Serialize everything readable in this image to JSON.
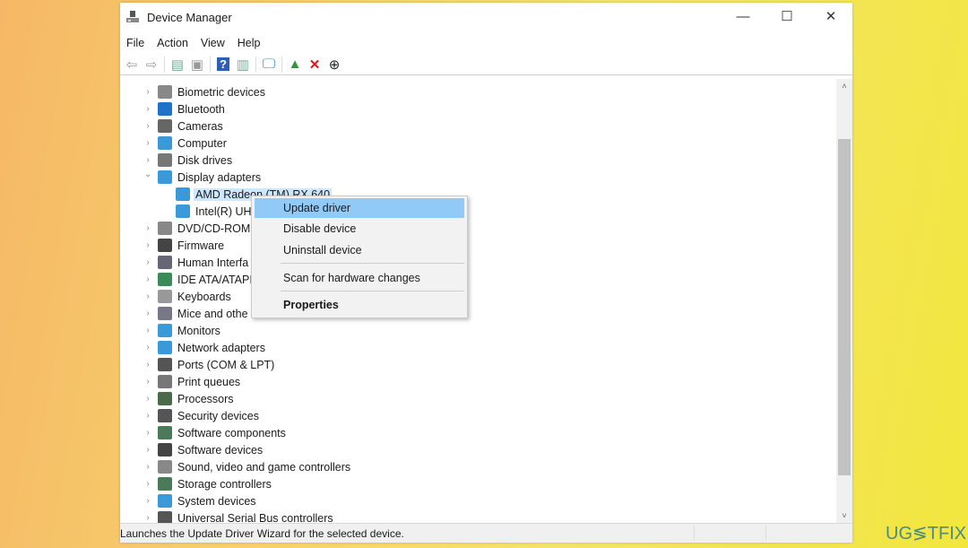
{
  "window": {
    "title": "Device Manager",
    "minimize": "—",
    "maximize": "☐",
    "close": "✕"
  },
  "menu": [
    "File",
    "Action",
    "View",
    "Help"
  ],
  "toolbar": [
    {
      "icon": "back-arrow-icon",
      "glyph": "⇦",
      "color": "#999"
    },
    {
      "icon": "forward-arrow-icon",
      "glyph": "⇨",
      "color": "#999"
    },
    {
      "icon": "show-hide-console-tree-icon",
      "glyph": "▤",
      "color": "#7a9"
    },
    {
      "icon": "properties-icon",
      "glyph": "▣",
      "color": "#999"
    },
    {
      "icon": "help-icon",
      "glyph": "?",
      "color": "#fff"
    },
    {
      "icon": "action-pane-icon",
      "glyph": "▥",
      "color": "#7a9"
    },
    {
      "icon": "monitor-scan-icon",
      "glyph": "🖵",
      "color": "#2a8fd0"
    },
    {
      "icon": "update-driver-icon",
      "glyph": "▲",
      "color": "#2a9a3a"
    },
    {
      "icon": "uninstall-x-icon",
      "glyph": "✕",
      "color": "#e01515"
    },
    {
      "icon": "download-circle-icon",
      "glyph": "⊕",
      "color": "#222"
    }
  ],
  "tree": [
    {
      "label": "Biometric devices",
      "level": 0,
      "expanded": false,
      "color": "#888"
    },
    {
      "label": "Bluetooth",
      "level": 0,
      "expanded": false,
      "color": "#1e73c8"
    },
    {
      "label": "Cameras",
      "level": 0,
      "expanded": false,
      "color": "#666"
    },
    {
      "label": "Computer",
      "level": 0,
      "expanded": false,
      "color": "#3a9ad9"
    },
    {
      "label": "Disk drives",
      "level": 0,
      "expanded": false,
      "color": "#777"
    },
    {
      "label": "Display adapters",
      "level": 0,
      "expanded": true,
      "color": "#3a9ad9"
    },
    {
      "label": "AMD Radeon (TM) RX 640",
      "level": 1,
      "selected": true,
      "color": "#3a9ad9"
    },
    {
      "label": "Intel(R) UHI",
      "level": 1,
      "color": "#3a9ad9"
    },
    {
      "label": "DVD/CD-ROM",
      "level": 0,
      "expanded": false,
      "color": "#888"
    },
    {
      "label": "Firmware",
      "level": 0,
      "expanded": false,
      "color": "#444"
    },
    {
      "label": "Human Interfa",
      "level": 0,
      "expanded": false,
      "color": "#667"
    },
    {
      "label": "IDE ATA/ATAPI c",
      "level": 0,
      "expanded": false,
      "color": "#3a8a5a"
    },
    {
      "label": "Keyboards",
      "level": 0,
      "expanded": false,
      "color": "#999"
    },
    {
      "label": "Mice and othe",
      "level": 0,
      "expanded": false,
      "color": "#778"
    },
    {
      "label": "Monitors",
      "level": 0,
      "expanded": false,
      "color": "#3a9ad9"
    },
    {
      "label": "Network adapters",
      "level": 0,
      "expanded": false,
      "color": "#3a9ad9"
    },
    {
      "label": "Ports (COM & LPT)",
      "level": 0,
      "expanded": false,
      "color": "#555"
    },
    {
      "label": "Print queues",
      "level": 0,
      "expanded": false,
      "color": "#777"
    },
    {
      "label": "Processors",
      "level": 0,
      "expanded": false,
      "color": "#4a6a4a"
    },
    {
      "label": "Security devices",
      "level": 0,
      "expanded": false,
      "color": "#555"
    },
    {
      "label": "Software components",
      "level": 0,
      "expanded": false,
      "color": "#4a7a5a"
    },
    {
      "label": "Software devices",
      "level": 0,
      "expanded": false,
      "color": "#444"
    },
    {
      "label": "Sound, video and game controllers",
      "level": 0,
      "expanded": false,
      "color": "#888"
    },
    {
      "label": "Storage controllers",
      "level": 0,
      "expanded": false,
      "color": "#4a7a5a"
    },
    {
      "label": "System devices",
      "level": 0,
      "expanded": false,
      "color": "#3a9ad9"
    },
    {
      "label": "Universal Serial Bus controllers",
      "level": 0,
      "expanded": false,
      "color": "#555"
    }
  ],
  "context_menu": {
    "items": [
      "Update driver",
      "Disable device",
      "Uninstall device",
      "Scan for hardware changes",
      "Properties"
    ],
    "highlighted": "Update driver"
  },
  "status": {
    "text": "Launches the Update Driver Wizard for the selected device."
  },
  "watermark": "UG≶TFIX"
}
